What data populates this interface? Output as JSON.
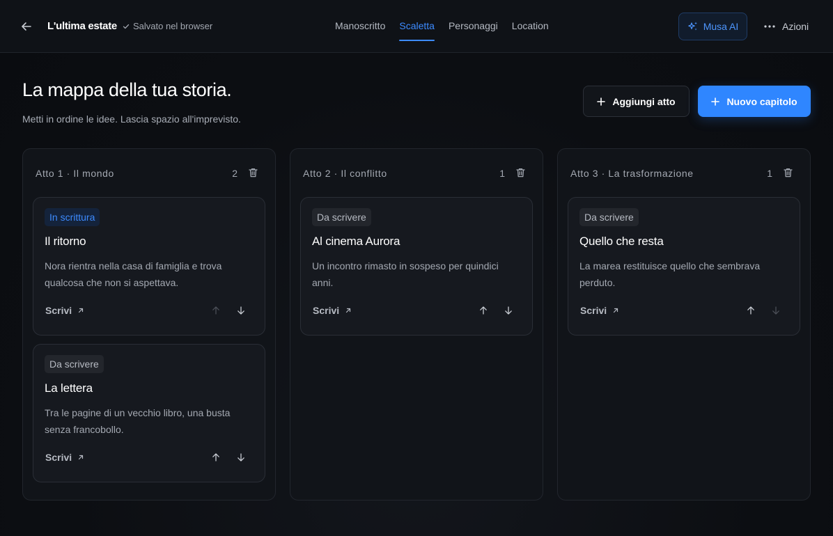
{
  "header": {
    "doc_title": "L'ultima estate",
    "saved_status": "Salvato nel browser",
    "tabs": [
      "Manoscritto",
      "Scaletta",
      "Personaggi",
      "Location"
    ],
    "active_tab": "Scaletta",
    "ai_button": "Musa AI",
    "actions_label": "Azioni"
  },
  "page": {
    "title": "La mappa della tua storia.",
    "subtitle": "Metti in ordine le idee. Lascia spazio all'imprevisto.",
    "add_act_label": "Aggiungi atto",
    "new_chapter_label": "Nuovo capitolo"
  },
  "acts": [
    {
      "title": "Atto 1 · Il mondo",
      "count": "2",
      "cards": [
        {
          "status": "In scrittura",
          "title": "Il ritorno",
          "description": "Nora rientra nella casa di famiglia e trova qualcosa che non si aspettava.",
          "write_label": "Scrivi"
        },
        {
          "status": "Da scrivere",
          "title": "La lettera",
          "description": "Tra le pagine di un vecchio libro, una busta senza francobollo.",
          "write_label": "Scrivi"
        }
      ]
    },
    {
      "title": "Atto 2 · Il conflitto",
      "count": "1",
      "cards": [
        {
          "status": "Da scrivere",
          "title": "Al cinema Aurora",
          "description": "Un incontro rimasto in sospeso per quindici anni.",
          "write_label": "Scrivi"
        }
      ]
    },
    {
      "title": "Atto 3 · La trasformazione",
      "count": "1",
      "cards": [
        {
          "status": "Da scrivere",
          "title": "Quello che resta",
          "description": "La marea restituisce quello che sembrava perduto.",
          "write_label": "Scrivi"
        }
      ]
    }
  ],
  "colors": {
    "accent": "#2f86ff",
    "background": "#0d1015",
    "card": "#16191f",
    "text_muted": "#a4a9b2"
  }
}
